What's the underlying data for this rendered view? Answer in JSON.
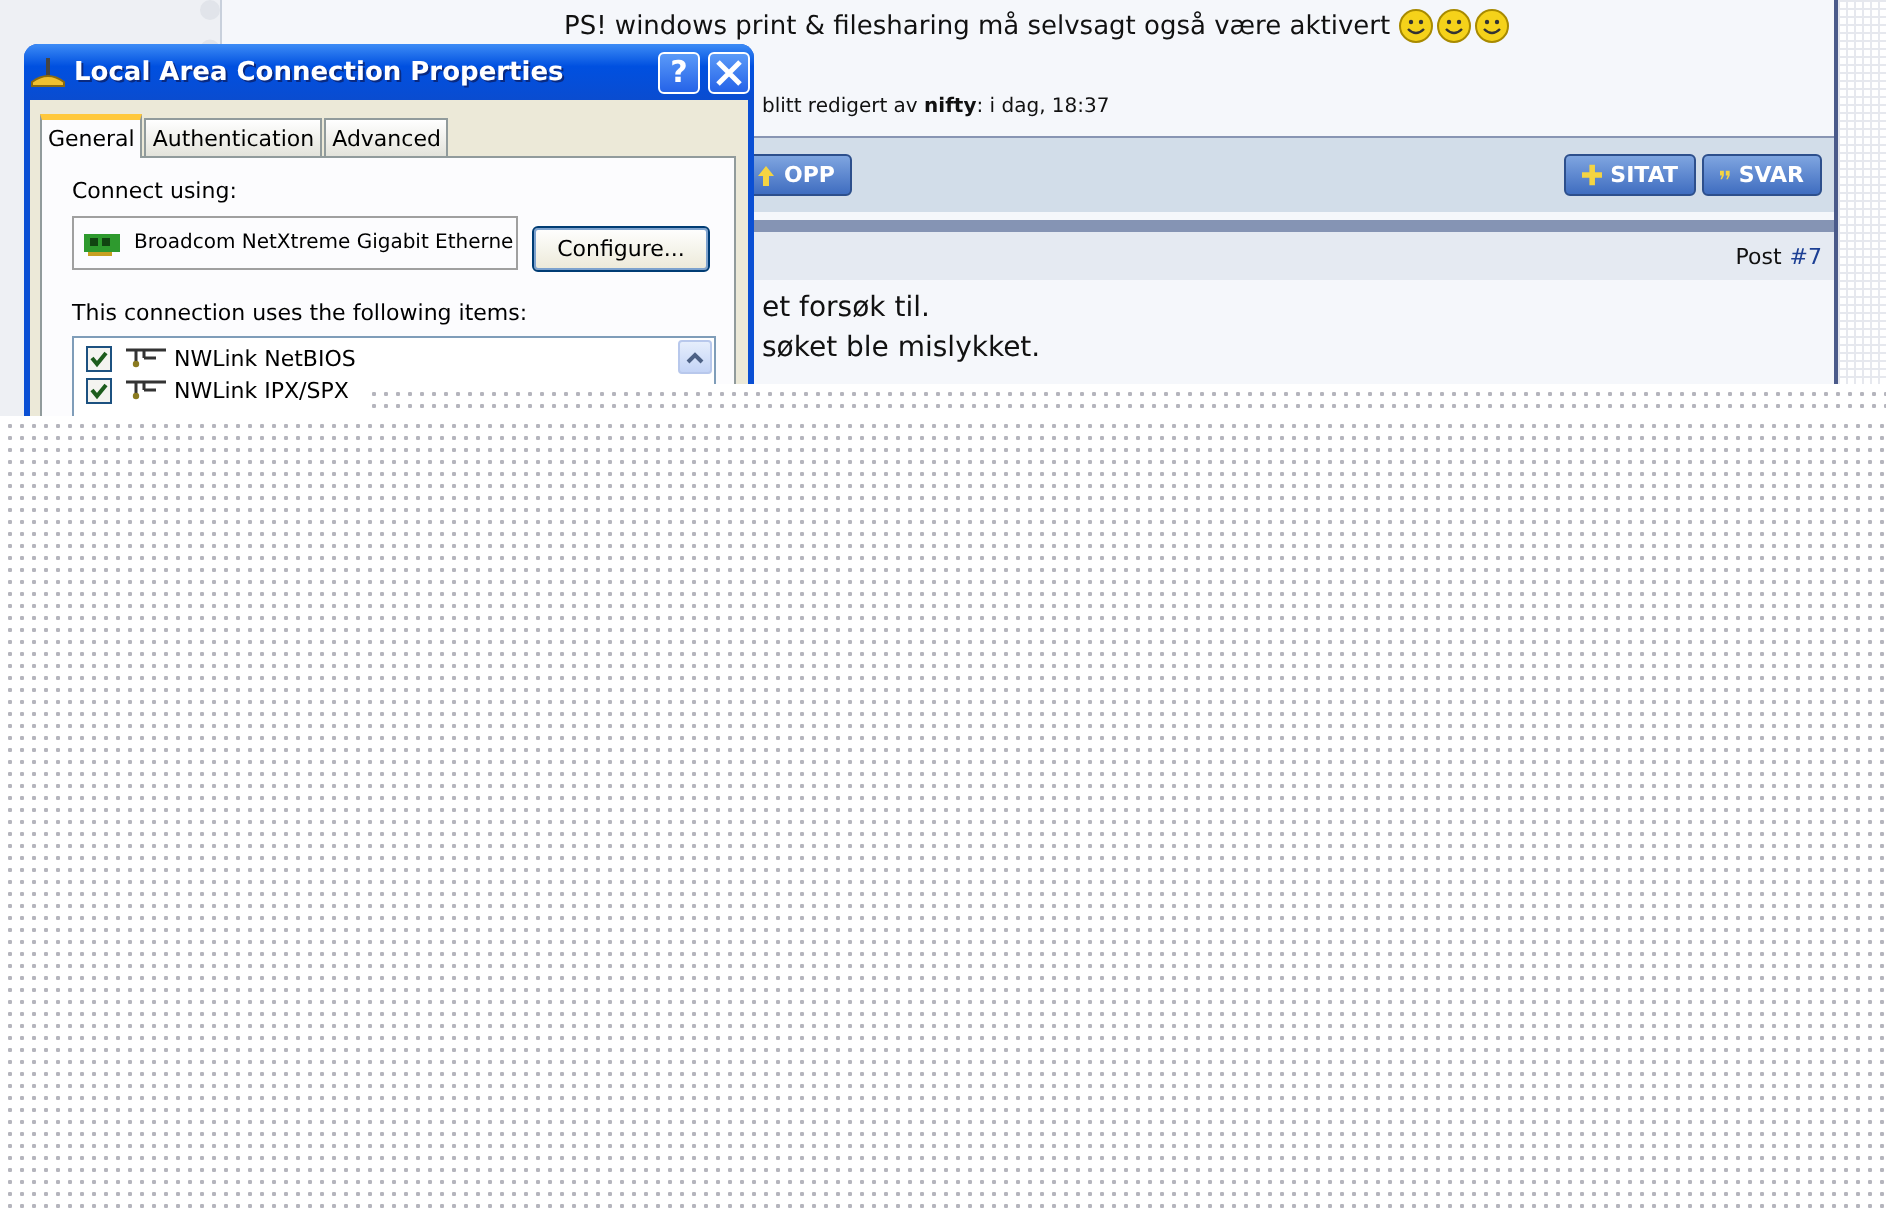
{
  "post": {
    "text": "PS! windows print & filesharing må selvsagt også være aktivert",
    "edit_note": "blitt redigert av **nifty**: i dag, 18:37"
  },
  "toolbar": {
    "left_buttons": [
      {
        "label": "OPP",
        "kind": "up"
      }
    ],
    "right_buttons": [
      {
        "label": "SITAT",
        "kind": "plus"
      },
      {
        "label": "SVAR",
        "kind": "quote"
      }
    ]
  },
  "next_post": {
    "label": "Post",
    "number": "#7",
    "lines": [
      "et forsøk til.",
      "søket ble mislykket."
    ]
  },
  "dialog": {
    "title": "Local Area Connection Properties",
    "help_button": "?",
    "tabs": [
      {
        "label": "General",
        "selected": true
      },
      {
        "label": "Authentication",
        "selected": false
      },
      {
        "label": "Advanced",
        "selected": false
      }
    ],
    "connect_label": "Connect using:",
    "adapter": "Broadcom NetXtreme Gigabit Etherne",
    "configure_button": "Configure...",
    "items_label": "This connection uses the following items:",
    "items": [
      {
        "label": "NWLink NetBIOS",
        "checked": true
      },
      {
        "label": "NWLink IPX/SPX",
        "checked": true
      }
    ]
  }
}
